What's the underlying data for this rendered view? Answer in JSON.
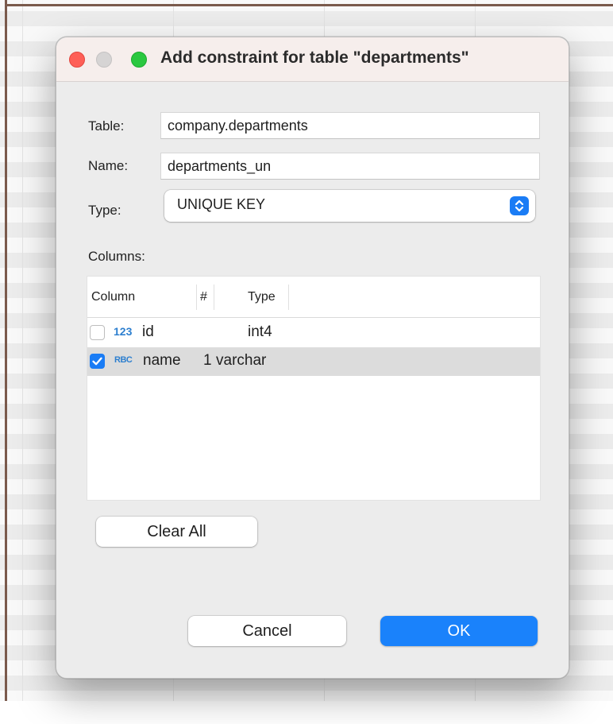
{
  "dialog": {
    "title": "Add constraint for table \"departments\"",
    "window_controls": [
      "close",
      "minimize",
      "maximize"
    ]
  },
  "form": {
    "table_label": "Table:",
    "table_value": "company.departments",
    "name_label": "Name:",
    "name_value": "departments_un",
    "type_label": "Type:",
    "type_value": "UNIQUE KEY"
  },
  "columns": {
    "label": "Columns:",
    "headers": {
      "column": "Column",
      "number": "#",
      "type": "Type"
    },
    "rows": [
      {
        "checked": false,
        "icon": "123",
        "name": "id",
        "position": "",
        "type": "int4",
        "selected": false
      },
      {
        "checked": true,
        "icon": "RBC",
        "name": "name",
        "position": "1",
        "type": "varchar",
        "selected": true
      }
    ]
  },
  "buttons": {
    "clear_all": "Clear All",
    "cancel": "Cancel",
    "ok": "OK"
  },
  "colors": {
    "accent": "#1a82fb",
    "close": "#fe5f57",
    "maximize": "#2ac840"
  }
}
